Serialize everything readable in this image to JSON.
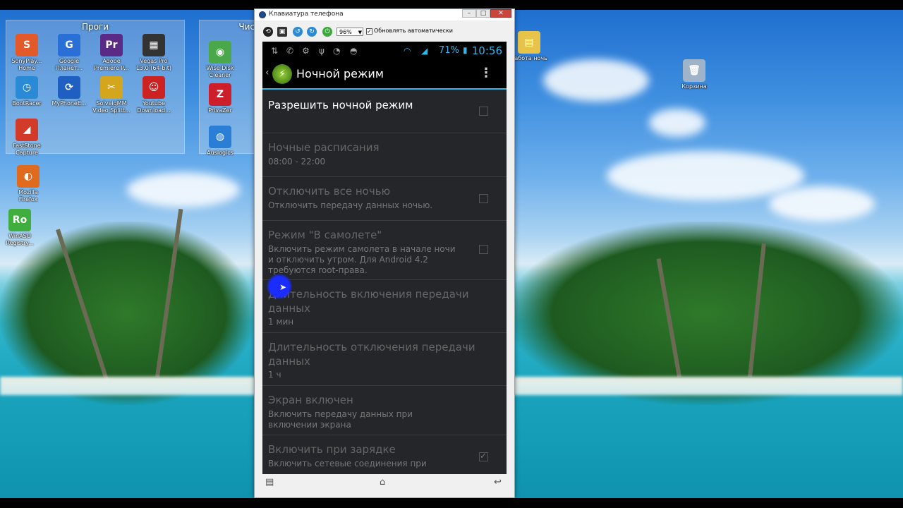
{
  "desktop": {
    "group_progs": {
      "title": "Проги",
      "icons": [
        {
          "label": "SonyPlay... Home",
          "glyph": "S",
          "color": "#e25a2a"
        },
        {
          "label": "Google Планет...",
          "glyph": "G",
          "color": "#2a6fd6"
        },
        {
          "label": "Adobe Premiere P...",
          "glyph": "Pr",
          "color": "#5b2a86"
        },
        {
          "label": "Vegas Pro 13.0 (64-bit)",
          "glyph": "▦",
          "color": "#333"
        },
        {
          "label": "BootRacer",
          "glyph": "◷",
          "color": "#2a8ad6"
        },
        {
          "label": "MyPhoneE...",
          "glyph": "⟳",
          "color": "#1f5fc2"
        },
        {
          "label": "SolveigMM Video Splitt...",
          "glyph": "✂",
          "color": "#d4a61e"
        },
        {
          "label": "Youtube Download...",
          "glyph": "☺",
          "color": "#cc2222"
        },
        {
          "label": "FastStone Capture",
          "glyph": "◢",
          "color": "#d23a2a"
        }
      ]
    },
    "group_clean": {
      "title": "Чис",
      "icons": [
        {
          "label": "Wise Disk Cleaner",
          "glyph": "◉",
          "color": "#4aa84a"
        },
        {
          "label": "PrivaZer",
          "glyph": "Z",
          "color": "#cc1f2a"
        },
        {
          "label": "Auslogics",
          "glyph": "◍",
          "color": "#2a7ed6"
        }
      ]
    },
    "loose_icons": [
      {
        "label": "Mozilla Firefox",
        "glyph": "◐",
        "color": "#e06a1e"
      },
      {
        "label": "WinASO Registry...",
        "glyph": "Ro",
        "color": "#3fae3f"
      },
      {
        "label": "Корзина",
        "glyph": "🗑",
        "color": "#9fb4c8"
      },
      {
        "label": "Забота ночь",
        "glyph": "▤",
        "color": "#e8c34a"
      }
    ]
  },
  "window": {
    "title": "Клавиатура телефона",
    "zoom": "96%",
    "auto_update_label": "Обновлять автоматически"
  },
  "phone": {
    "battery": "71%",
    "time": "10:56",
    "screen_title": "Ночной режим",
    "accent": "#33b5e5",
    "settings": [
      {
        "title": "Разрешить ночной режим",
        "summary": "",
        "checkbox": "unchecked",
        "enabled": true
      },
      {
        "title": "Ночные расписания",
        "summary": "08:00 - 22:00",
        "checkbox": "none",
        "enabled": false
      },
      {
        "title": "Отключить все ночью",
        "summary": "Отключить передачу данных ночью.",
        "checkbox": "unchecked",
        "enabled": false
      },
      {
        "title": "Режим \"В самолете\"",
        "summary": "Включить режим самолета в начале ночи и отключить утром. Для Android 4.2 требуются root-права.",
        "checkbox": "unchecked",
        "enabled": false
      },
      {
        "title": "Длительность включения передачи данных",
        "summary": "1 мин",
        "checkbox": "none",
        "enabled": false
      },
      {
        "title": "Длительность отключения передачи данных",
        "summary": "1 ч",
        "checkbox": "none",
        "enabled": false
      },
      {
        "title": "Экран включен",
        "summary": "Включить передачу данных при включении экрана",
        "checkbox": "none",
        "enabled": false
      },
      {
        "title": "Включить при зарядке",
        "summary": "Включить сетевые соединения при",
        "checkbox": "checked",
        "enabled": false
      }
    ]
  }
}
